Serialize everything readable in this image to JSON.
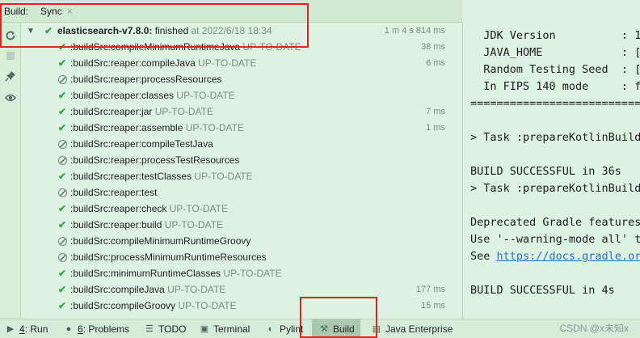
{
  "header": {
    "build_label": "Build:",
    "sync_tab": "Sync",
    "close_glyph": "×"
  },
  "toolbar": {
    "icons": [
      "refresh-icon",
      "stop-icon",
      "pin-icon",
      "eye-icon"
    ]
  },
  "tree": {
    "root": {
      "name": "elasticsearch-v7.8.0:",
      "status": " finished",
      "timestamp": "at 2022/6/18 18:34",
      "duration": "1 m 4 s 814 ms"
    },
    "rows": [
      {
        "task": ":buildSrc:compileMinimumRuntimeJava",
        "state": "UP-TO-DATE",
        "time": "38 ms",
        "icon": "check"
      },
      {
        "task": ":buildSrc:reaper:compileJava",
        "state": "UP-TO-DATE",
        "time": "6 ms",
        "icon": "check"
      },
      {
        "task": ":buildSrc:reaper:processResources",
        "state": "",
        "time": "",
        "icon": "skip"
      },
      {
        "task": ":buildSrc:reaper:classes",
        "state": "UP-TO-DATE",
        "time": "",
        "icon": "check"
      },
      {
        "task": ":buildSrc:reaper:jar",
        "state": "UP-TO-DATE",
        "time": "7 ms",
        "icon": "check"
      },
      {
        "task": ":buildSrc:reaper:assemble",
        "state": "UP-TO-DATE",
        "time": "1 ms",
        "icon": "check"
      },
      {
        "task": ":buildSrc:reaper:compileTestJava",
        "state": "",
        "time": "",
        "icon": "skip"
      },
      {
        "task": ":buildSrc:reaper:processTestResources",
        "state": "",
        "time": "",
        "icon": "skip"
      },
      {
        "task": ":buildSrc:reaper:testClasses",
        "state": "UP-TO-DATE",
        "time": "",
        "icon": "check"
      },
      {
        "task": ":buildSrc:reaper:test",
        "state": "",
        "time": "",
        "icon": "skip"
      },
      {
        "task": ":buildSrc:reaper:check",
        "state": "UP-TO-DATE",
        "time": "",
        "icon": "check"
      },
      {
        "task": ":buildSrc:reaper:build",
        "state": "UP-TO-DATE",
        "time": "",
        "icon": "check"
      },
      {
        "task": ":buildSrc:compileMinimumRuntimeGroovy",
        "state": "",
        "time": "",
        "icon": "skip"
      },
      {
        "task": ":buildSrc:processMinimumRuntimeResources",
        "state": "",
        "time": "",
        "icon": "skip"
      },
      {
        "task": ":buildSrc:minimumRuntimeClasses",
        "state": "UP-TO-DATE",
        "time": "",
        "icon": "check"
      },
      {
        "task": ":buildSrc:compileJava",
        "state": "UP-TO-DATE",
        "time": "177 ms",
        "icon": "check"
      },
      {
        "task": ":buildSrc:compileGroovy",
        "state": "UP-TO-DATE",
        "time": "15 ms",
        "icon": "check"
      }
    ]
  },
  "console": {
    "lines": [
      "  JDK Version          : 1",
      "  JAVA_HOME            : [",
      "  Random Testing Seed  : [",
      "  In FIPS 140 mode     : f",
      "==================================",
      "",
      "> Task :prepareKotlinBuildS",
      "",
      "BUILD SUCCESSFUL in 36s",
      "> Task :prepareKotlinBuildS",
      "",
      "Deprecated Gradle features",
      "Use '--warning-mode all' to",
      "",
      "",
      "BUILD SUCCESSFUL in 4s"
    ],
    "link_prefix": "See ",
    "link_text": "https://docs.gradle.org"
  },
  "bottom_tabs": {
    "run": {
      "mnemonic": "4",
      "label": ": Run"
    },
    "problems": {
      "mnemonic": "6",
      "label": ": Problems"
    },
    "todo": "TODO",
    "terminal": "Terminal",
    "pylint": "Pylint",
    "build": "Build",
    "java_enterprise": "Java Enterprise"
  },
  "watermark": "CSDN @x未知x",
  "colors": {
    "background": "#ddf2e0",
    "success_check": "#37a44b",
    "highlight_box": "#e32222",
    "link": "#2b6fc0"
  }
}
